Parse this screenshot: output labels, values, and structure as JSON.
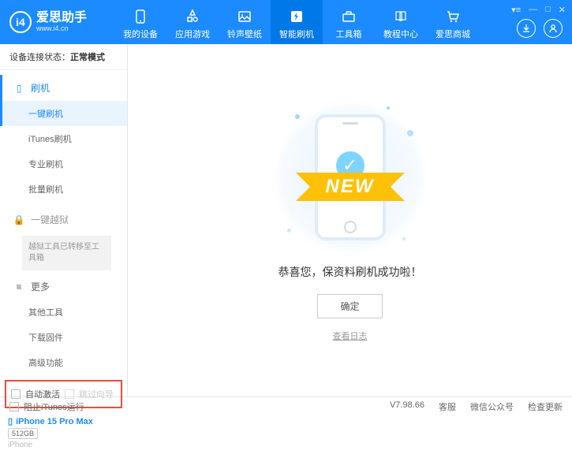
{
  "logo": {
    "title": "爱思助手",
    "url": "www.i4.cn"
  },
  "nav": [
    {
      "label": "我的设备"
    },
    {
      "label": "应用游戏"
    },
    {
      "label": "铃声壁纸"
    },
    {
      "label": "智能刷机"
    },
    {
      "label": "工具箱"
    },
    {
      "label": "教程中心"
    },
    {
      "label": "爱思商城"
    }
  ],
  "status": {
    "label": "设备连接状态：",
    "value": "正常模式"
  },
  "sidebar": {
    "flash_head": "刷机",
    "items": [
      "一键刷机",
      "iTunes刷机",
      "专业刷机",
      "批量刷机"
    ],
    "jailbreak_head": "一键越狱",
    "jailbreak_note": "越狱工具已转移至工具箱",
    "more_head": "更多",
    "more_items": [
      "其他工具",
      "下载固件",
      "高级功能"
    ],
    "auto_activate": "自动激活",
    "skip_guide": "跳过向导"
  },
  "device": {
    "name": "iPhone 15 Pro Max",
    "storage": "512GB",
    "type": "iPhone"
  },
  "main": {
    "ribbon": "NEW",
    "success": "恭喜您，保资料刷机成功啦！",
    "ok": "确定",
    "log": "查看日志"
  },
  "footer": {
    "block_itunes": "阻止iTunes运行",
    "version": "V7.98.66",
    "links": [
      "客服",
      "微信公众号",
      "检查更新"
    ]
  }
}
